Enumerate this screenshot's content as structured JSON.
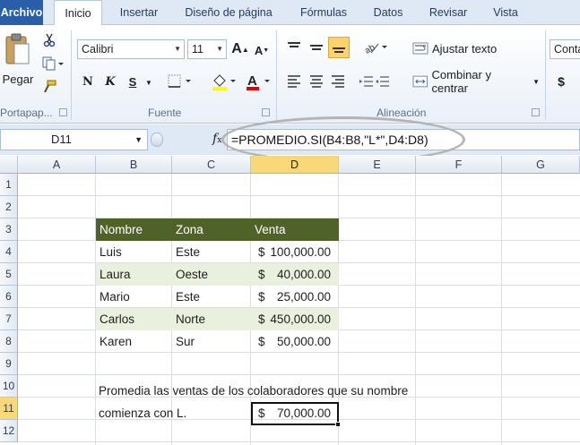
{
  "tabs": [
    "Archivo",
    "Inicio",
    "Insertar",
    "Diseño de página",
    "Fórmulas",
    "Datos",
    "Revisar",
    "Vista"
  ],
  "ribbon": {
    "clipboard": {
      "paste": "Pegar",
      "label": "Portapap..."
    },
    "font": {
      "name": "Calibri",
      "size": "11",
      "bold": "N",
      "italic": "K",
      "underline": "S",
      "label": "Fuente"
    },
    "alignment": {
      "wrap": "Ajustar texto",
      "merge": "Combinar y centrar",
      "label": "Alineación"
    },
    "number": {
      "format": "Conta",
      "currency": "$"
    }
  },
  "formula_bar": {
    "name_box": "D11",
    "fx": "f",
    "formula": "=PROMEDIO.SI(B4:B8,\"L*\",D4:D8)"
  },
  "sheet": {
    "columns": [
      "A",
      "B",
      "C",
      "D",
      "E",
      "F",
      "G"
    ],
    "rows": [
      "1",
      "2",
      "3",
      "4",
      "5",
      "6",
      "7",
      "8",
      "9",
      "10",
      "11",
      "12"
    ],
    "table_headers": [
      "Nombre",
      "Zona",
      "Venta"
    ],
    "table_rows": [
      {
        "name": "Luis",
        "zone": "Este",
        "cur": "$",
        "amount": "100,000.00"
      },
      {
        "name": "Laura",
        "zone": "Oeste",
        "cur": "$",
        "amount": "40,000.00"
      },
      {
        "name": "Mario",
        "zone": "Este",
        "cur": "$",
        "amount": "25,000.00"
      },
      {
        "name": "Carlos",
        "zone": "Norte",
        "cur": "$",
        "amount": "450,000.00"
      },
      {
        "name": "Karen",
        "zone": "Sur",
        "cur": "$",
        "amount": "50,000.00"
      }
    ],
    "note_line1": "Promedia las ventas de los colaboradores que su nombre",
    "note_line2": "comienza con L.",
    "result_cur": "$",
    "result_amount": "70,000.00"
  },
  "colors": {
    "header_fill": "#4f6228",
    "band_fill": "#eaf0de",
    "file_tab": "#2a5ea8",
    "selected_header": "#f9d87a"
  }
}
